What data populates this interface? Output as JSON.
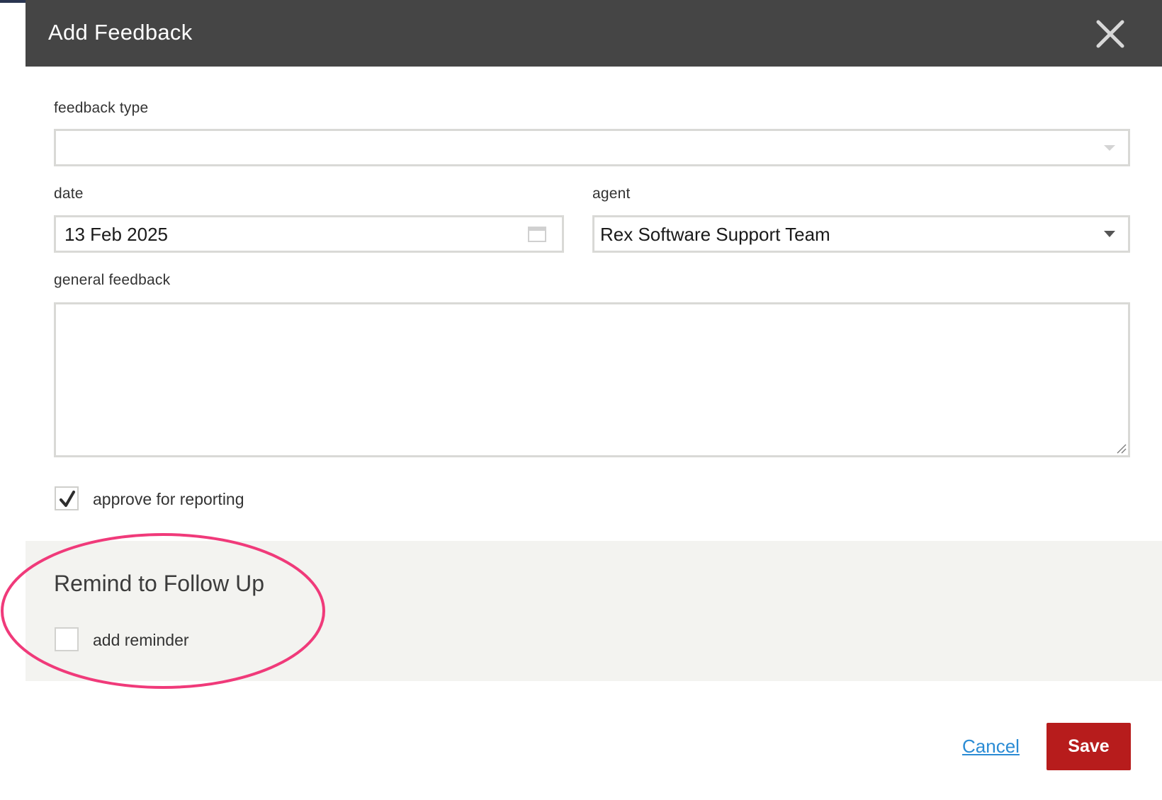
{
  "dialog": {
    "title": "Add Feedback",
    "close_icon": "close-icon"
  },
  "form": {
    "feedback_type": {
      "label": "feedback type",
      "value": ""
    },
    "date": {
      "label": "date",
      "value": "13 Feb 2025",
      "icon": "calendar-icon"
    },
    "agent": {
      "label": "agent",
      "value": "Rex Software Support Team"
    },
    "general_feedback": {
      "label": "general feedback",
      "value": ""
    },
    "approve": {
      "label": "approve for reporting",
      "checked": true
    }
  },
  "reminder": {
    "title": "Remind to Follow Up",
    "add_reminder": {
      "label": "add reminder",
      "checked": false
    }
  },
  "actions": {
    "cancel_label": "Cancel",
    "save_label": "Save"
  },
  "colors": {
    "header_bg": "#454545",
    "save_bg": "#b71c1c",
    "link": "#2a8bd4",
    "highlight": "#f03a7a"
  }
}
